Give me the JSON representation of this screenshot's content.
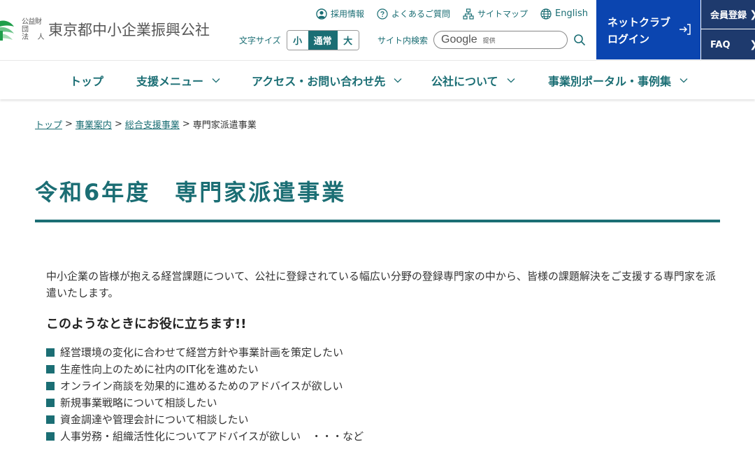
{
  "header": {
    "logo": {
      "corp_type_line1": "公益財団",
      "corp_type_line2_a": "法",
      "corp_type_line2_b": "人",
      "name": "東京都中小企業振興公社"
    },
    "utility_links": [
      {
        "label": "採用情報",
        "icon": "person-circle-icon"
      },
      {
        "label": "よくあるご質問",
        "icon": "question-circle-icon"
      },
      {
        "label": "サイトマップ",
        "icon": "sitemap-icon"
      },
      {
        "label": "English",
        "icon": "globe-icon"
      }
    ],
    "font_size": {
      "label": "文字サイズ",
      "options": [
        "小",
        "通常",
        "大"
      ],
      "selected": "通常"
    },
    "search": {
      "label": "サイト内検索",
      "placeholder_brand": "Google",
      "placeholder_suffix": "提供"
    },
    "login": {
      "line1": "ネットクラブ",
      "line2": "ログイン"
    },
    "side_buttons": [
      {
        "label": "会員登録"
      },
      {
        "label": "FAQ"
      }
    ]
  },
  "nav": {
    "items": [
      {
        "label": "トップ",
        "has_dropdown": false
      },
      {
        "label": "支援メニュー",
        "has_dropdown": true
      },
      {
        "label": "アクセス・お問い合わせ先",
        "has_dropdown": true
      },
      {
        "label": "公社について",
        "has_dropdown": true
      },
      {
        "label": "事業別ポータル・事例集",
        "has_dropdown": true
      }
    ]
  },
  "breadcrumb": {
    "items": [
      {
        "label": "トップ",
        "link": true
      },
      {
        "label": "事業案内",
        "link": true
      },
      {
        "label": "総合支援事業",
        "link": true
      },
      {
        "label": "専門家派遣事業",
        "link": false
      }
    ],
    "separator": ">"
  },
  "page": {
    "title": "令和6年度　専門家派遣事業",
    "intro": "中小企業の皆様が抱える経営課題について、公社に登録されている幅広い分野の登録専門家の中から、皆様の課題解決をご支援する専門家を派遣いたします。",
    "sub_heading": "このようなときにお役に立ちます!!",
    "bullets": [
      "経営環境の変化に合わせて経営方針や事業計画を策定したい",
      "生産性向上のために社内のIT化を進めたい",
      "オンライン商談を効果的に進めるためのアドバイスが欲しい",
      "新規事業戦略について相談したい",
      "資金調達や管理会計について相談したい",
      "人事労務・組織活性化についてアドバイスが欲しい　・・・など"
    ]
  },
  "colors": {
    "brand_teal": "#1b6e74",
    "login_blue": "#0b45b0",
    "side_navy": "#1e3a6d",
    "logo_green": "#1e9e4a"
  }
}
